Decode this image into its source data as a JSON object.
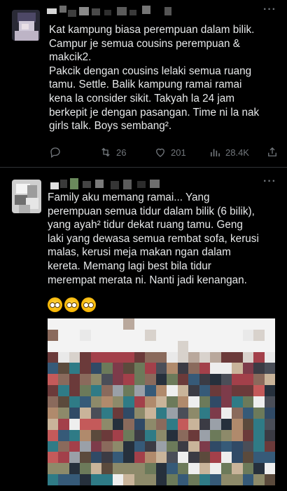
{
  "tweets": [
    {
      "text": "Kat kampung biasa perempuan dalam bilik.\nCampur je semua cousins perempuan &\nmakcik2.\nPakcik dengan cousins lelaki semua ruang\ntamu. Settle. Balik kampung ramai ramai\nkena la consider sikit. Takyah la 24 jam\nberkepit je dengan pasangan. Time ni la nak\ngirls talk. Boys sembang².",
      "stats": {
        "replies": "",
        "retweets": "26",
        "likes": "201",
        "views": "28.4K"
      }
    },
    {
      "text": "Family aku memang ramai... Yang\nperempuan semua tidur dalam bilik (6 bilik),\nyang ayah² tidur dekat ruang tamu. Geng\nlaki yang dewasa semua rembat sofa, kerusi\nmalas, kerusi meja makan ngan dalam\nkereta. Memang lagi best bila tidur\nmerempat merata ni. Nanti jadi kenangan.",
      "emojis": [
        "pleading-face",
        "pleading-face",
        "pleading-face"
      ]
    }
  ],
  "icons": {
    "reply": "reply-icon",
    "retweet": "retweet-icon",
    "like": "heart-icon",
    "views": "views-icon",
    "share": "share-icon",
    "more": "more-icon"
  },
  "colors": {
    "background": "#000000",
    "text": "#e7e9ea",
    "muted": "#71767b",
    "divider": "#2f3336"
  }
}
